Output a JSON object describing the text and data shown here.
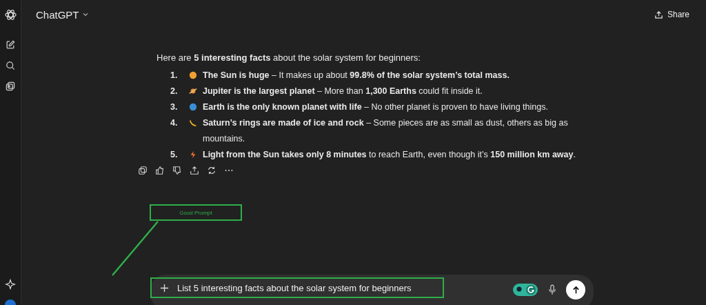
{
  "header": {
    "title": "ChatGPT",
    "share": "Share"
  },
  "intro": "Here are **5 interesting facts** about the solar system for beginners:",
  "facts": [
    {
      "number": "1.",
      "kind": "sun",
      "text": "**The Sun is huge** – It makes up about **99.8% of the solar system’s total mass.**"
    },
    {
      "number": "2.",
      "kind": "planet",
      "text": "**Jupiter is the largest planet** – More than **1,300 Earths** could fit inside it."
    },
    {
      "number": "3.",
      "kind": "earth",
      "text": "**Earth is the only known planet with life** – No other planet is proven to have living things."
    },
    {
      "number": "4.",
      "kind": "comet",
      "text": "**Saturn’s rings are made of ice and rock** – Some pieces are as small as dust, others as big as mountains."
    },
    {
      "number": "5.",
      "kind": "bolt",
      "text": "**Light from the Sun takes only 8 minutes** to reach Earth, even though it’s **150 million km away**."
    }
  ],
  "annotation": {
    "label": "Good Prompt"
  },
  "composer": {
    "value": "List 5 interesting facts about the solar system for beginners"
  }
}
